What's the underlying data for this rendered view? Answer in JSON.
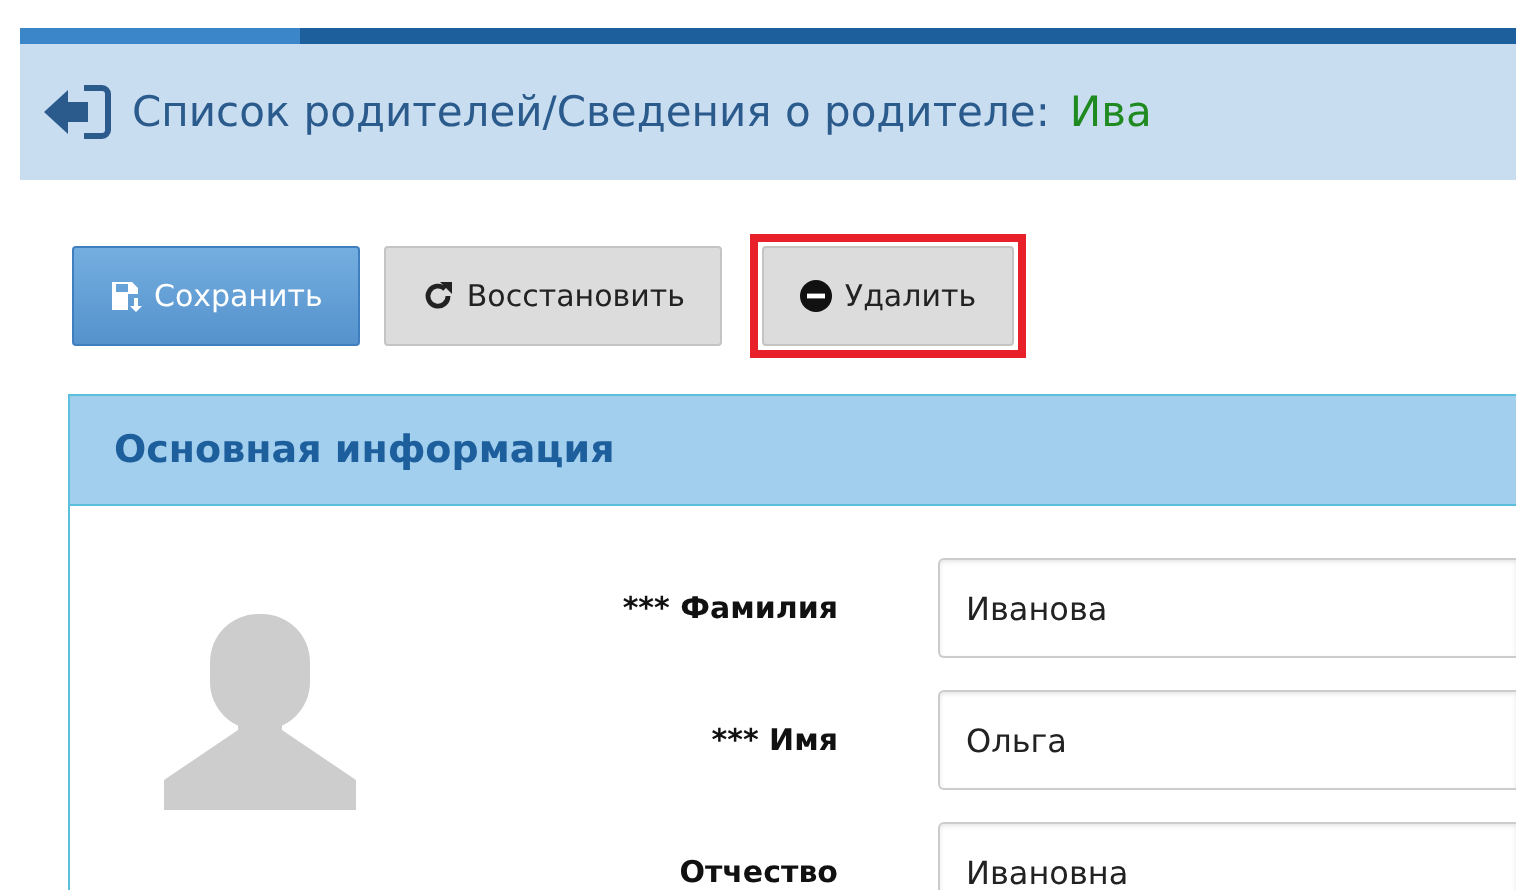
{
  "header": {
    "crumbs": [
      {
        "text": "Список родителей"
      },
      {
        "text": "Сведения о родителе:"
      }
    ],
    "separator": "/",
    "subject": "Ива"
  },
  "toolbar": [
    {
      "label": "Сохранить",
      "kind": "primary",
      "highlighted": false
    },
    {
      "label": "Восстановить",
      "kind": "restore",
      "highlighted": false
    },
    {
      "label": "Удалить",
      "kind": "delete",
      "highlighted": true
    }
  ],
  "panel": {
    "title": "Основная информация",
    "fields": [
      {
        "label": "Фамилия",
        "required_mark": "***",
        "value": "Иванова"
      },
      {
        "label": "Имя",
        "required_mark": "***",
        "value": "Ольга"
      },
      {
        "label": "Отчество",
        "value": "Ивановна"
      }
    ]
  }
}
